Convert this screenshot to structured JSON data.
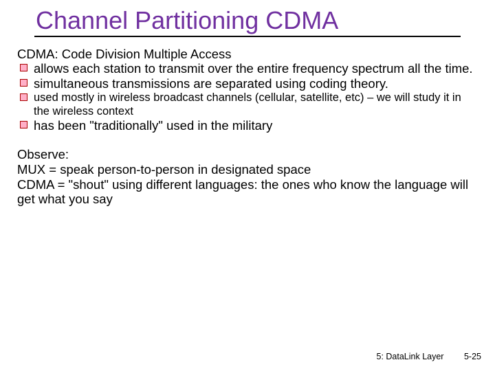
{
  "title": "Channel Partitioning CDMA",
  "subhead": "CDMA: Code Division Multiple Access",
  "bullets": [
    {
      "text": "allows each station to transmit over the entire frequency spectrum all the time.",
      "small": false
    },
    {
      "text": "simultaneous transmissions are separated using coding theory.",
      "small": false
    },
    {
      "text": "used mostly in wireless broadcast channels (cellular, satellite, etc) – we will study it in the wireless context",
      "small": true
    },
    {
      "text": "has been \"traditionally\" used in the military",
      "small": false
    }
  ],
  "observe": {
    "heading": "Observe:",
    "lines": [
      "MUX = speak person-to-person in designated space",
      "CDMA = \"shout\" using different languages: the ones who know the language will get what you say"
    ]
  },
  "footer": {
    "section": "5: DataLink Layer",
    "slidenum": "5-25"
  }
}
